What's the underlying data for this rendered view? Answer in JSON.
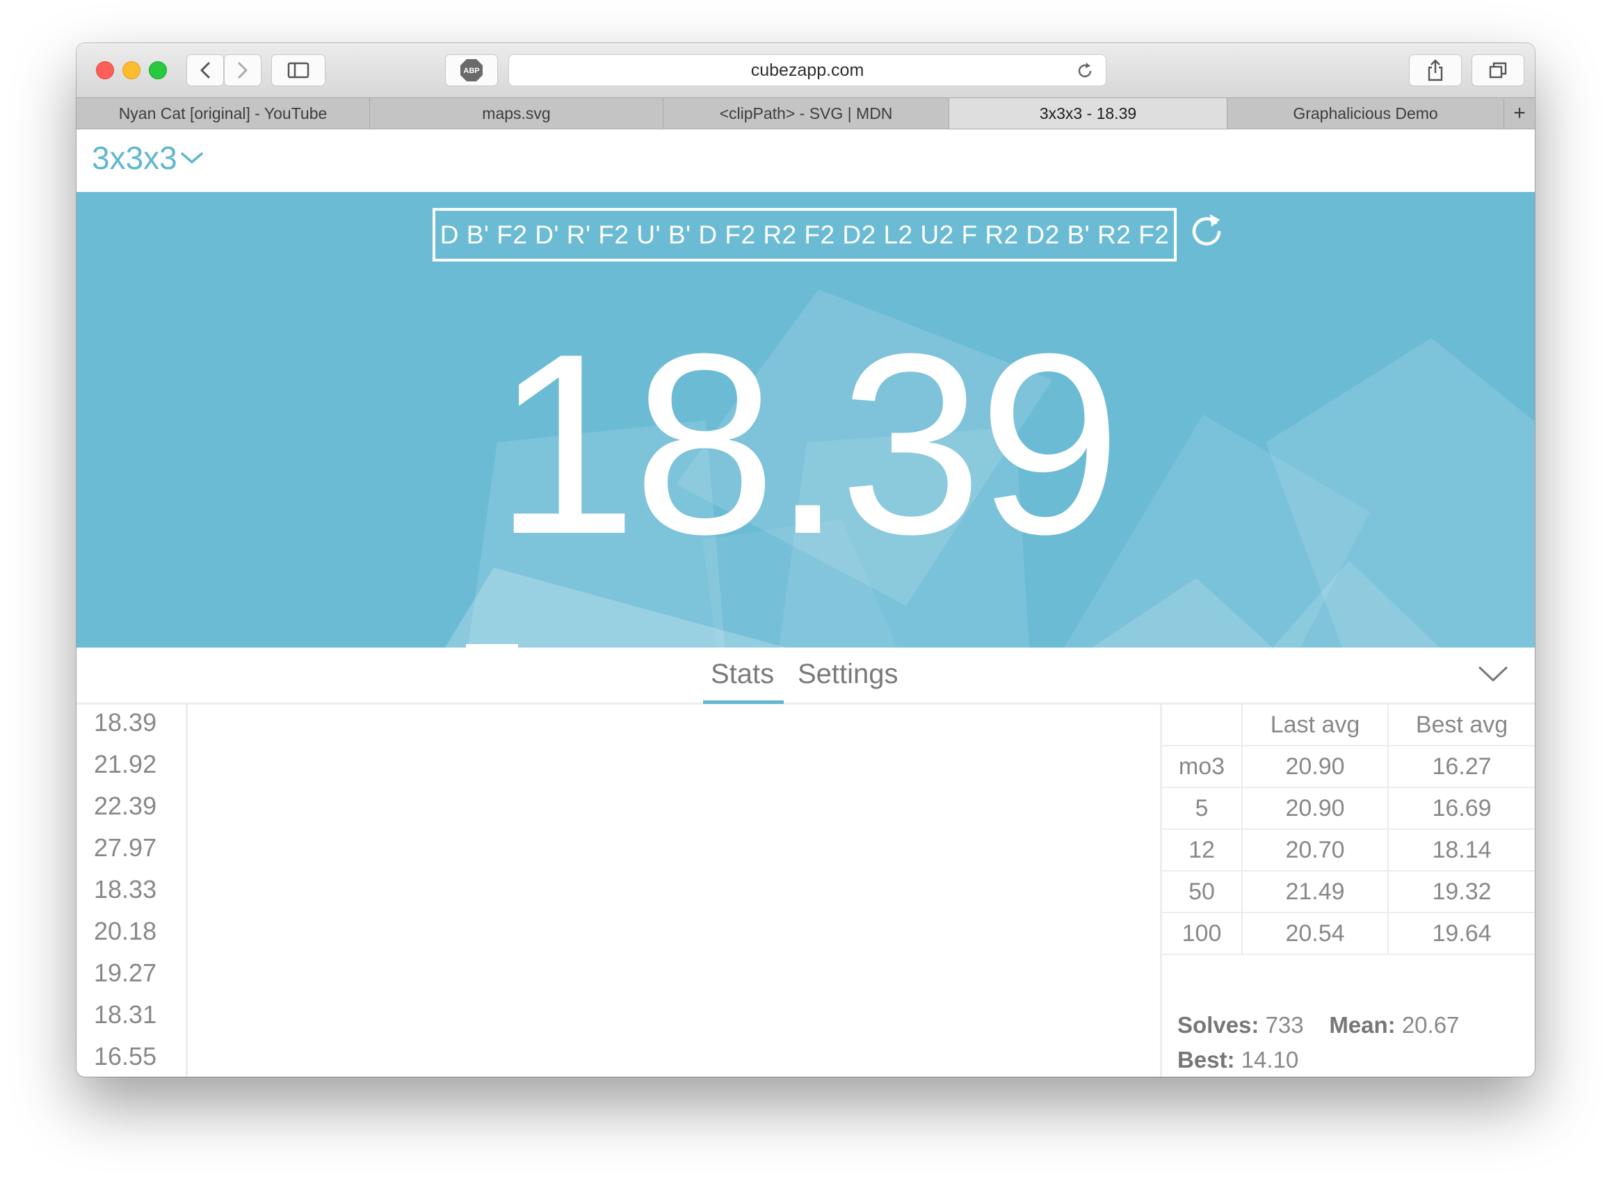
{
  "browser": {
    "url": "cubezapp.com",
    "adblock_label": "ABP",
    "tabs": [
      {
        "label": "Nyan Cat [original] - YouTube",
        "active": false
      },
      {
        "label": "maps.svg",
        "active": false
      },
      {
        "label": "<clipPath> - SVG | MDN",
        "active": false
      },
      {
        "label": "3x3x3 - 18.39",
        "active": true
      },
      {
        "label": "Graphalicious Demo",
        "active": false
      }
    ],
    "new_tab_label": "+"
  },
  "header": {
    "puzzle": "3x3x3",
    "accent_color": "#5fb7cf"
  },
  "timer": {
    "scramble": "D B' F2 D' R' F2 U' B' D F2 R2 F2 D2 L2 U2 F R2 D2 B' R2 F2",
    "time": "18.39",
    "background_color": "#6bbbd5"
  },
  "panel": {
    "tabs": [
      {
        "label": "Stats",
        "active": true
      },
      {
        "label": "Settings",
        "active": false
      }
    ]
  },
  "times": [
    "18.39",
    "21.92",
    "22.39",
    "27.97",
    "18.33",
    "20.18",
    "19.27",
    "18.31",
    "16.55"
  ],
  "stats": {
    "headers": [
      "",
      "Last avg",
      "Best avg"
    ],
    "rows": [
      {
        "label": "mo3",
        "last": "20.90",
        "best": "16.27"
      },
      {
        "label": "5",
        "last": "20.90",
        "best": "16.69"
      },
      {
        "label": "12",
        "last": "20.70",
        "best": "18.14"
      },
      {
        "label": "50",
        "last": "21.49",
        "best": "19.32"
      },
      {
        "label": "100",
        "last": "20.54",
        "best": "19.64"
      }
    ],
    "solves_label": "Solves:",
    "solves_value": "733",
    "mean_label": "Mean:",
    "mean_value": "20.67",
    "best_label": "Best:",
    "best_value": "14.10"
  }
}
